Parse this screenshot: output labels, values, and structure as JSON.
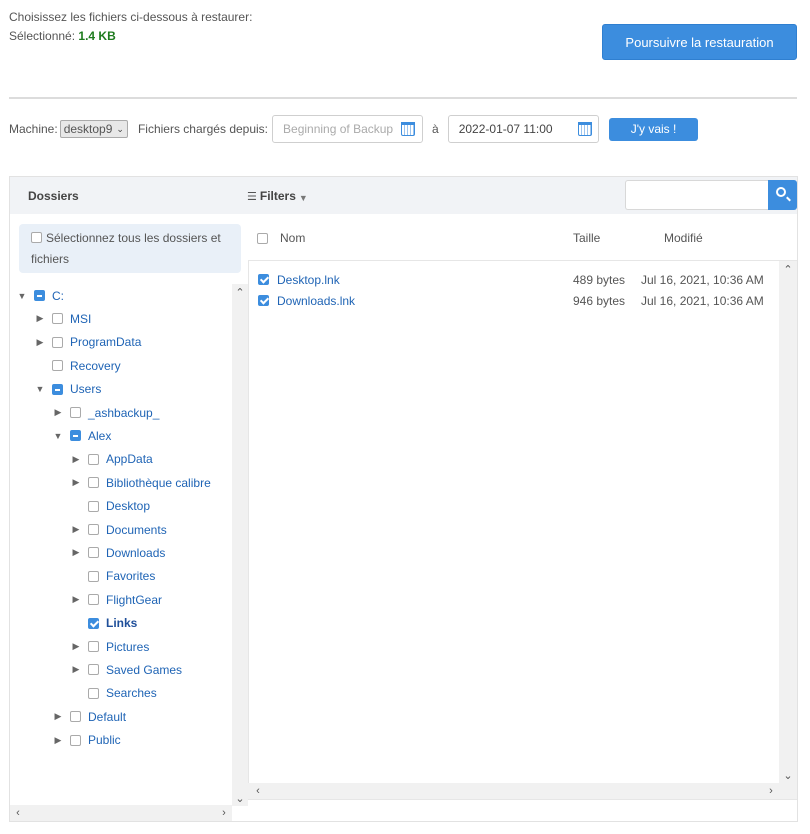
{
  "intro": {
    "line1": "Choisissez les fichiers ci-dessous à restaurer:",
    "selected_label": "Sélectionné:",
    "selected_size": "1.4 KB"
  },
  "restore_button": "Poursuivre la restauration",
  "toolbar": {
    "machine_label": "Machine:",
    "machine_value": "desktop9",
    "loaded_label": "Fichiers chargés depuis:",
    "from_placeholder": "Beginning of Backup",
    "to_label": "à",
    "to_value": "2022-01-07 11:00",
    "go_button": "J'y vais !"
  },
  "panel": {
    "folders_title": "Dossiers",
    "filters_label": "Filters",
    "search_placeholder": "",
    "select_all_label": "Sélectionnez tous les dossiers et fichiers",
    "columns": {
      "name": "Nom",
      "size": "Taille",
      "modified": "Modifié"
    }
  },
  "tree": [
    {
      "label": "C:",
      "state": "partial",
      "arrow": "open"
    },
    {
      "label": "MSI",
      "state": "none",
      "arrow": "closed"
    },
    {
      "label": "ProgramData",
      "state": "none",
      "arrow": "closed"
    },
    {
      "label": "Recovery",
      "state": "none",
      "arrow": "empty"
    },
    {
      "label": "Users",
      "state": "partial",
      "arrow": "open"
    },
    {
      "label": "_ashbackup_",
      "state": "none",
      "arrow": "closed"
    },
    {
      "label": "Alex",
      "state": "partial",
      "arrow": "open"
    },
    {
      "label": "AppData",
      "state": "none",
      "arrow": "closed"
    },
    {
      "label": "Bibliothèque calibre",
      "state": "none",
      "arrow": "closed"
    },
    {
      "label": "Desktop",
      "state": "none",
      "arrow": "empty"
    },
    {
      "label": "Documents",
      "state": "none",
      "arrow": "closed"
    },
    {
      "label": "Downloads",
      "state": "none",
      "arrow": "closed"
    },
    {
      "label": "Favorites",
      "state": "none",
      "arrow": "empty"
    },
    {
      "label": "FlightGear",
      "state": "none",
      "arrow": "closed"
    },
    {
      "label": "Links",
      "state": "checked",
      "arrow": "empty",
      "bold": true
    },
    {
      "label": "Pictures",
      "state": "none",
      "arrow": "closed"
    },
    {
      "label": "Saved Games",
      "state": "none",
      "arrow": "closed"
    },
    {
      "label": "Searches",
      "state": "none",
      "arrow": "empty"
    },
    {
      "label": "Default",
      "state": "none",
      "arrow": "closed"
    },
    {
      "label": "Public",
      "state": "none",
      "arrow": "closed"
    }
  ],
  "files": [
    {
      "name": "Desktop.lnk",
      "size": "489 bytes",
      "modified": "Jul 16, 2021, 10:36 AM",
      "checked": true
    },
    {
      "name": "Downloads.lnk",
      "size": "946 bytes",
      "modified": "Jul 16, 2021, 10:36 AM",
      "checked": true
    }
  ],
  "colors": {
    "accent": "#3c8dde",
    "link": "#1f64b5",
    "size_green": "#1e7b1e"
  }
}
